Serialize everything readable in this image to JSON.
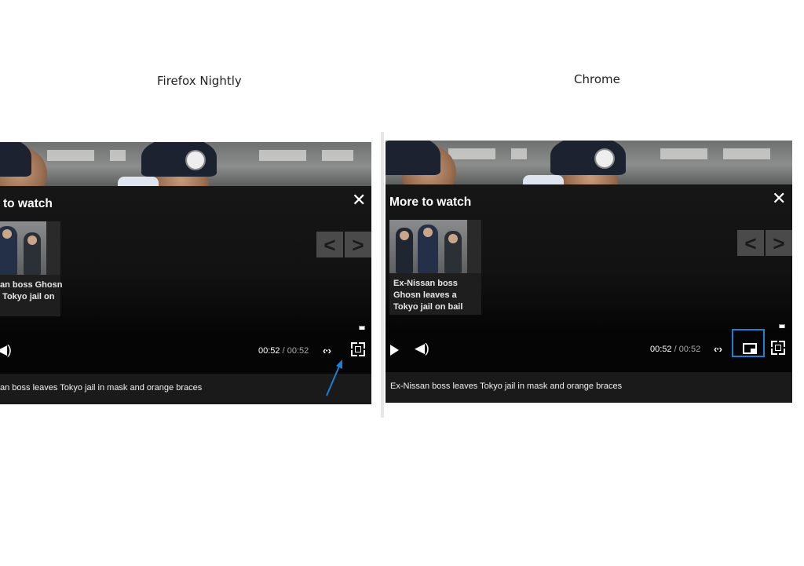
{
  "labels": {
    "firefox": "Firefox Nightly",
    "chrome": "Chrome"
  },
  "firefox_player": {
    "more_to_watch_title": "to watch",
    "video_card_title": "an boss Ghosn\n Tokyo jail on",
    "current_time": "00:52",
    "separator": "/",
    "duration": "00:52",
    "caption": "an boss leaves Tokyo jail in mask and orange braces",
    "progress": 1.0
  },
  "chrome_player": {
    "more_to_watch_title": "More to watch",
    "video_card_title": "Ex-Nissan boss Ghosn leaves a Tokyo jail on bail",
    "current_time": "00:52",
    "separator": "/",
    "duration": "00:52",
    "caption": "Ex-Nissan boss leaves Tokyo jail in mask and orange braces",
    "progress": 1.0
  },
  "icons": {
    "close": "close-icon",
    "prev": "chevron-left-icon",
    "next": "chevron-right-icon",
    "play": "play-icon",
    "volume": "volume-icon",
    "embed": "embed-code-icon",
    "pip": "picture-in-picture-icon",
    "fullscreen": "fullscreen-icon"
  },
  "colors": {
    "progress": "#c3161c",
    "highlight": "#1f7fd1",
    "background": "#0a0a0a"
  }
}
